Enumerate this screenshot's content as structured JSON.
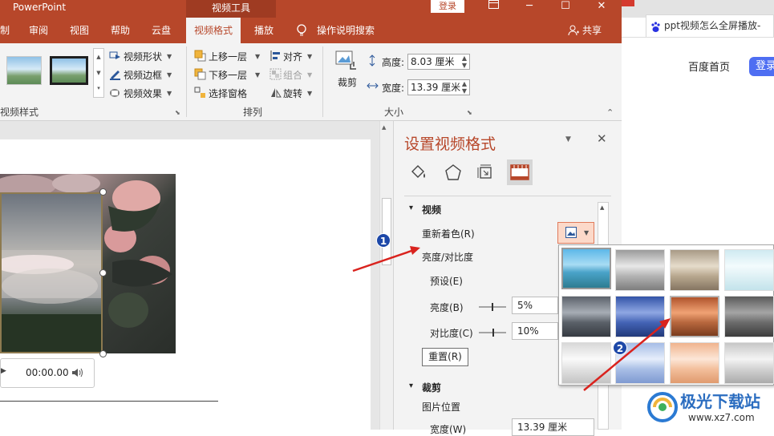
{
  "app": {
    "title": "PowerPoint",
    "contextual_tab_group": "视频工具",
    "login": "登录",
    "share": "共享",
    "tell_me": "操作说明搜索"
  },
  "tabs": [
    {
      "label": "制"
    },
    {
      "label": "审阅"
    },
    {
      "label": "视图"
    },
    {
      "label": "帮助"
    },
    {
      "label": "云盘"
    },
    {
      "label": "视频格式"
    },
    {
      "label": "播放"
    }
  ],
  "ribbon": {
    "video_styles": {
      "shape": "视频形状",
      "border": "视频边框",
      "effects": "视频效果",
      "group_label": "视频样式"
    },
    "arrange": {
      "bring_forward": "上移一层",
      "send_backward": "下移一层",
      "selection_pane": "选择窗格",
      "align": "对齐",
      "group": "组合",
      "rotate": "旋转",
      "group_label": "排列"
    },
    "size": {
      "crop": "裁剪",
      "height_label": "高度:",
      "height_value": "8.03 厘米",
      "width_label": "宽度:",
      "width_value": "13.39 厘米",
      "group_label": "大小"
    }
  },
  "player": {
    "time": "00:00.00"
  },
  "pane": {
    "title": "设置视频格式",
    "section_video": "视频",
    "recolor": "重新着色(R)",
    "brightness_contrast": "亮度/对比度",
    "presets": "预设(E)",
    "brightness_label": "亮度(B)",
    "brightness_value": "5%",
    "contrast_label": "对比度(C)",
    "contrast_value": "10%",
    "reset": "重置(R)",
    "section_crop": "裁剪",
    "picture_position": "图片位置",
    "width_label": "宽度(W)",
    "width_value": "13.39 厘米"
  },
  "browser": {
    "tab_title": "ppt视频怎么全屏播放-",
    "home": "百度首页",
    "login": "登录"
  },
  "annotations": {
    "badge1": "1",
    "badge2": "2",
    "arrow_color": "#d9231e",
    "badge_color": "#1d48a8"
  },
  "watermark": {
    "name": "极光下载站",
    "url": "www.xz7.com"
  },
  "colors": {
    "accent": "#b7472a",
    "ribbon_bg": "#f3f3f3"
  }
}
